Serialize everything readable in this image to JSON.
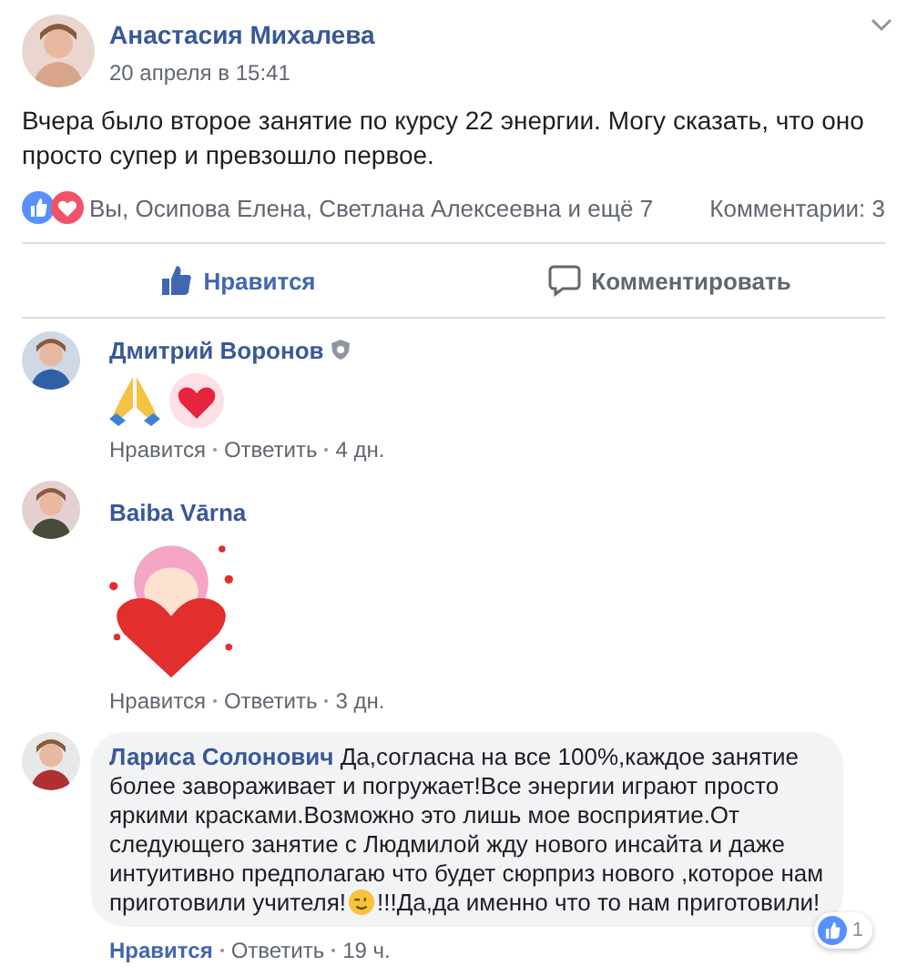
{
  "post": {
    "author": "Анастасия Михалева",
    "time": "20 апреля в 15:41",
    "text": "Вчера было второе занятие по курсу 22 энергии. Могу сказать, что оно просто супер и превзошло первое.",
    "reactions": {
      "names": "Вы, Осипова Елена, Светлана Алексеевна и ещё 7",
      "comments": "Комментарии: 3"
    },
    "actions": [
      {
        "kind": "like",
        "label": "Нравится",
        "selected": true
      },
      {
        "kind": "comment",
        "label": "Комментировать",
        "selected": false
      }
    ]
  },
  "comments": [
    {
      "kind": "emoji",
      "author": "Дмитрий Воронов",
      "badge": true,
      "like": "Нравится",
      "liked": false,
      "reply": "Ответить",
      "time": "4 дн."
    },
    {
      "kind": "sticker",
      "author": "Baiba Vārna",
      "badge": false,
      "like": "Нравится",
      "liked": false,
      "reply": "Ответить",
      "time": "3 дн."
    },
    {
      "kind": "text",
      "author": "Лариса Солонович",
      "badge": false,
      "text_parts": [
        "Да,согласна на все 100%,каждое занятие более завораживает и погружает!Все энергии играют просто яркими красками.Возможно это лишь мое восприятие.От следующего занятие с Людмилой жду нового инсайта и даже интуитивно предполагаю что будет сюрприз нового ,которое нам приготовили учителя!",
        "!!!Да,да именно что то нам приготовили!"
      ],
      "reaction_count": "1",
      "like": "Нравится",
      "liked": true,
      "reply": "Ответить",
      "time": "19 ч."
    }
  ]
}
